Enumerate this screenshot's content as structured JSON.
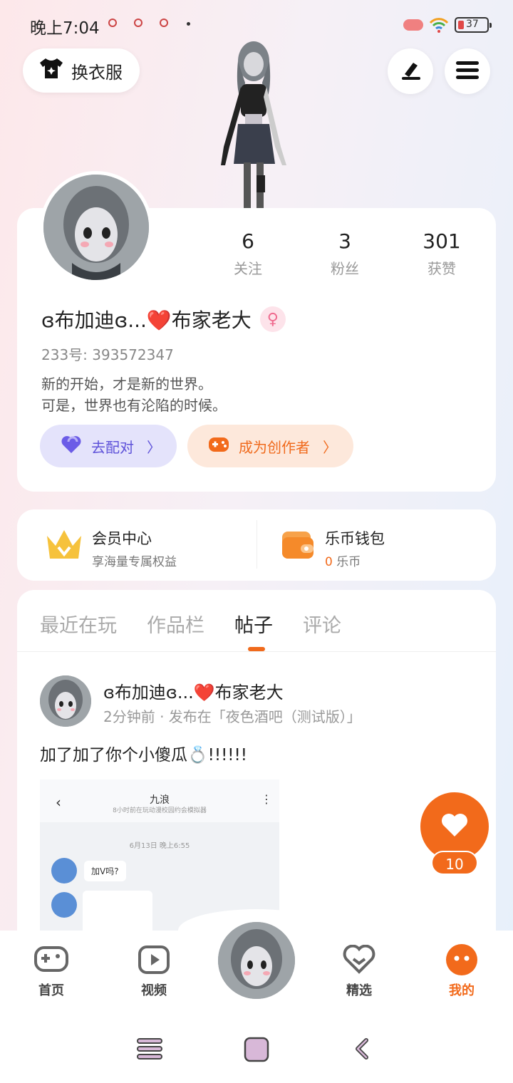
{
  "status": {
    "time": "晚上7:04",
    "battery": "37"
  },
  "header": {
    "outfit_label": "换衣服"
  },
  "profile": {
    "stats": [
      {
        "n": "6",
        "l": "关注"
      },
      {
        "n": "3",
        "l": "粉丝"
      },
      {
        "n": "301",
        "l": "获赞"
      }
    ],
    "name": "ɞ布加迪ɞ...❤️布家老大",
    "gender_icon": "♀",
    "uid": "233号: 393572347",
    "bio_line1": "新的开始，才是新的世界。",
    "bio_line2": "可是，世界也有沦陷的时候。",
    "match_label": "去配对",
    "creator_label": "成为创作者"
  },
  "vip": {
    "title": "会员中心",
    "sub": "享海量专属权益",
    "wallet_title": "乐币钱包",
    "wallet_value": "0",
    "wallet_unit": "乐币"
  },
  "tabs": [
    "最近在玩",
    "作品栏",
    "帖子",
    "评论"
  ],
  "post": {
    "author": "ɞ布加迪ɞ...❤️布家老大",
    "meta": "2分钟前 · 发布在「夜色酒吧（测试版）」",
    "text": "加了加了你个小傻瓜💍!!!!!!",
    "likes": "10",
    "shot": {
      "title": "九浪",
      "subtitle": "8小时前在玩动漫校园约会模拟器",
      "date": "6月13日 晚上6:55",
      "msg": "加V吗?"
    }
  },
  "nav": [
    {
      "label": "首页"
    },
    {
      "label": "视频"
    },
    {
      "label": "精选"
    },
    {
      "label": "我的"
    }
  ],
  "colors": {
    "accent": "#f26a1b",
    "purple": "#6b5ce7"
  }
}
